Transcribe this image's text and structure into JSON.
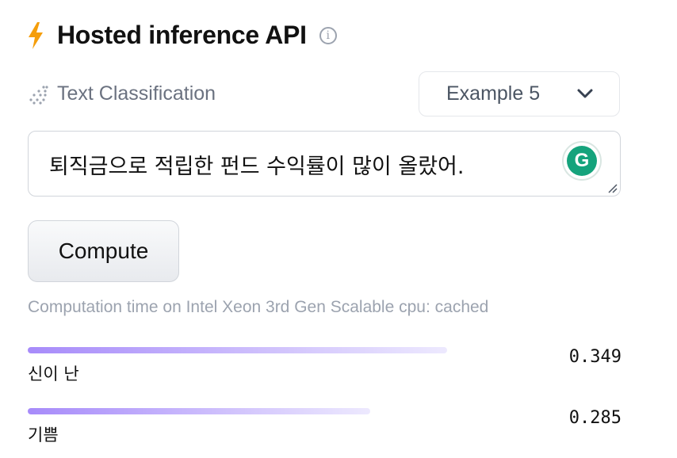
{
  "header": {
    "title": "Hosted inference API",
    "bolt_color": "#f59e0b"
  },
  "task": {
    "label": "Text Classification"
  },
  "example_select": {
    "selected": "Example 5"
  },
  "input": {
    "text": "퇴직금으로 적립한 펀드 수익률이 많이 올랐어."
  },
  "grammarly": {
    "letter": "G",
    "color": "#15a37c"
  },
  "compute_button": {
    "label": "Compute"
  },
  "timing": {
    "text": "Computation time on Intel Xeon 3rd Gen Scalable cpu: cached"
  },
  "results": [
    {
      "label": "신이 난",
      "score_text": "0.349",
      "score": 0.349
    },
    {
      "label": "기쁨",
      "score_text": "0.285",
      "score": 0.285
    }
  ],
  "bar_colors": {
    "start": "#a78bfa",
    "end": "#ede9fe"
  }
}
